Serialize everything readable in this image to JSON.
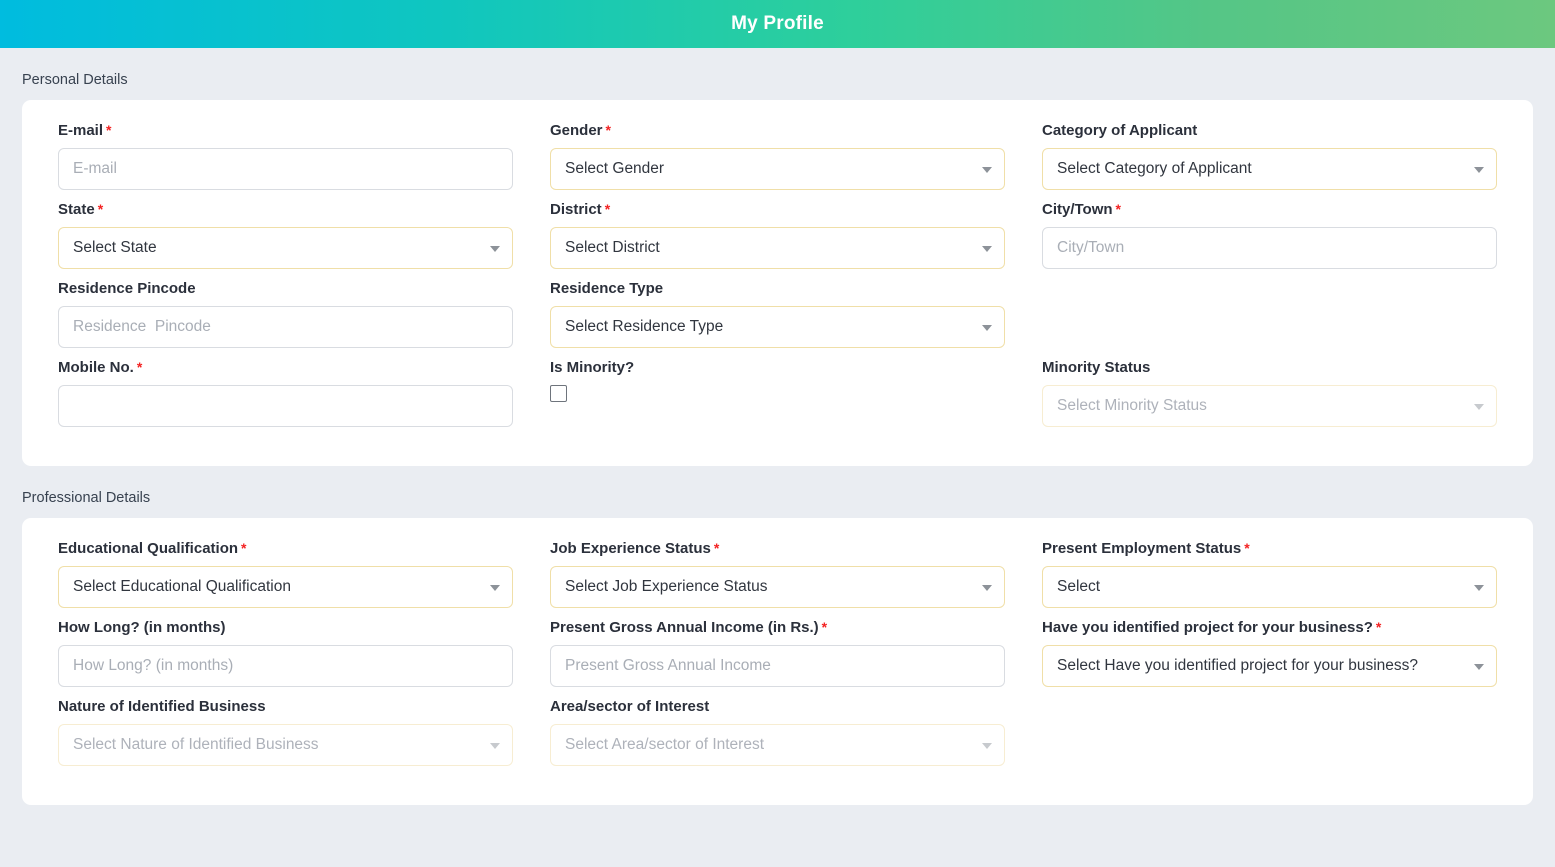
{
  "header": {
    "title": "My Profile",
    "gradient_from": "#00bcdf",
    "gradient_to": "#6cc87f"
  },
  "theme": {
    "page_bg": "#eaedf2",
    "card_bg": "#ffffff",
    "select_border": "#f0dfa8",
    "input_border": "#d9dce1",
    "required_marker": "#f32222"
  },
  "sections": [
    {
      "label": "Personal Details",
      "fields": [
        {
          "name": "email",
          "label": "E-mail",
          "required": true,
          "type": "text",
          "value": "",
          "placeholder": "E-mail",
          "disabled": false
        },
        {
          "name": "gender",
          "label": "Gender",
          "required": true,
          "type": "select",
          "value": "Select Gender",
          "disabled": false
        },
        {
          "name": "category-of-applicant",
          "label": "Category of Applicant",
          "required": false,
          "type": "select",
          "value": "Select Category of Applicant",
          "disabled": false
        },
        {
          "name": "state",
          "label": "State",
          "required": true,
          "type": "select",
          "value": "Select State",
          "disabled": false
        },
        {
          "name": "district",
          "label": "District",
          "required": true,
          "type": "select",
          "value": "Select District",
          "disabled": false
        },
        {
          "name": "city-town",
          "label": "City/Town",
          "required": true,
          "type": "text",
          "value": "",
          "placeholder": "City/Town",
          "disabled": false
        },
        {
          "name": "residence-pincode",
          "label": "Residence Pincode",
          "required": false,
          "type": "text",
          "value": "",
          "placeholder": "Residence  Pincode",
          "disabled": false
        },
        {
          "name": "residence-type",
          "label": "Residence Type",
          "required": false,
          "type": "select",
          "value": "Select Residence Type",
          "disabled": false
        },
        {
          "name": "empty-slot-1",
          "label": "",
          "required": false,
          "type": "empty",
          "value": "",
          "disabled": false
        },
        {
          "name": "mobile-no",
          "label": "Mobile No.",
          "required": true,
          "type": "text",
          "value": "",
          "placeholder": "",
          "disabled": false
        },
        {
          "name": "is-minority",
          "label": "Is Minority?",
          "required": false,
          "type": "checkbox",
          "value": "",
          "checked": false,
          "disabled": false
        },
        {
          "name": "minority-status",
          "label": "Minority Status",
          "required": false,
          "type": "select",
          "value": "Select Minority Status",
          "disabled": true
        }
      ]
    },
    {
      "label": "Professional Details",
      "fields": [
        {
          "name": "educational-qualification",
          "label": "Educational Qualification",
          "required": true,
          "type": "select",
          "value": "Select Educational Qualification",
          "disabled": false
        },
        {
          "name": "job-experience-status",
          "label": "Job Experience Status",
          "required": true,
          "type": "select",
          "value": "Select Job Experience Status",
          "disabled": false
        },
        {
          "name": "present-employment-status",
          "label": "Present Employment Status",
          "required": true,
          "type": "select",
          "value": "Select",
          "disabled": false
        },
        {
          "name": "how-long-in-months",
          "label": "How Long? (in months)",
          "required": false,
          "type": "text",
          "value": "",
          "placeholder": "How Long? (in months)",
          "disabled": false
        },
        {
          "name": "present-gross-annual-income",
          "label": "Present Gross Annual Income (in Rs.)",
          "required": true,
          "type": "text",
          "value": "",
          "placeholder": "Present Gross Annual Income",
          "disabled": false
        },
        {
          "name": "have-you-identified-project",
          "label": "Have you identified project for your business?",
          "required": true,
          "type": "select",
          "value": "Select Have you identified project for your business?",
          "disabled": false
        },
        {
          "name": "nature-of-identified-business",
          "label": "Nature of Identified Business",
          "required": false,
          "type": "select",
          "value": "Select Nature of Identified Business",
          "disabled": true
        },
        {
          "name": "area-sector-of-interest",
          "label": "Area/sector of Interest",
          "required": false,
          "type": "select",
          "value": "Select Area/sector of Interest",
          "disabled": true
        },
        {
          "name": "empty-slot-2",
          "label": "",
          "required": false,
          "type": "empty",
          "value": "",
          "disabled": false
        }
      ]
    }
  ]
}
